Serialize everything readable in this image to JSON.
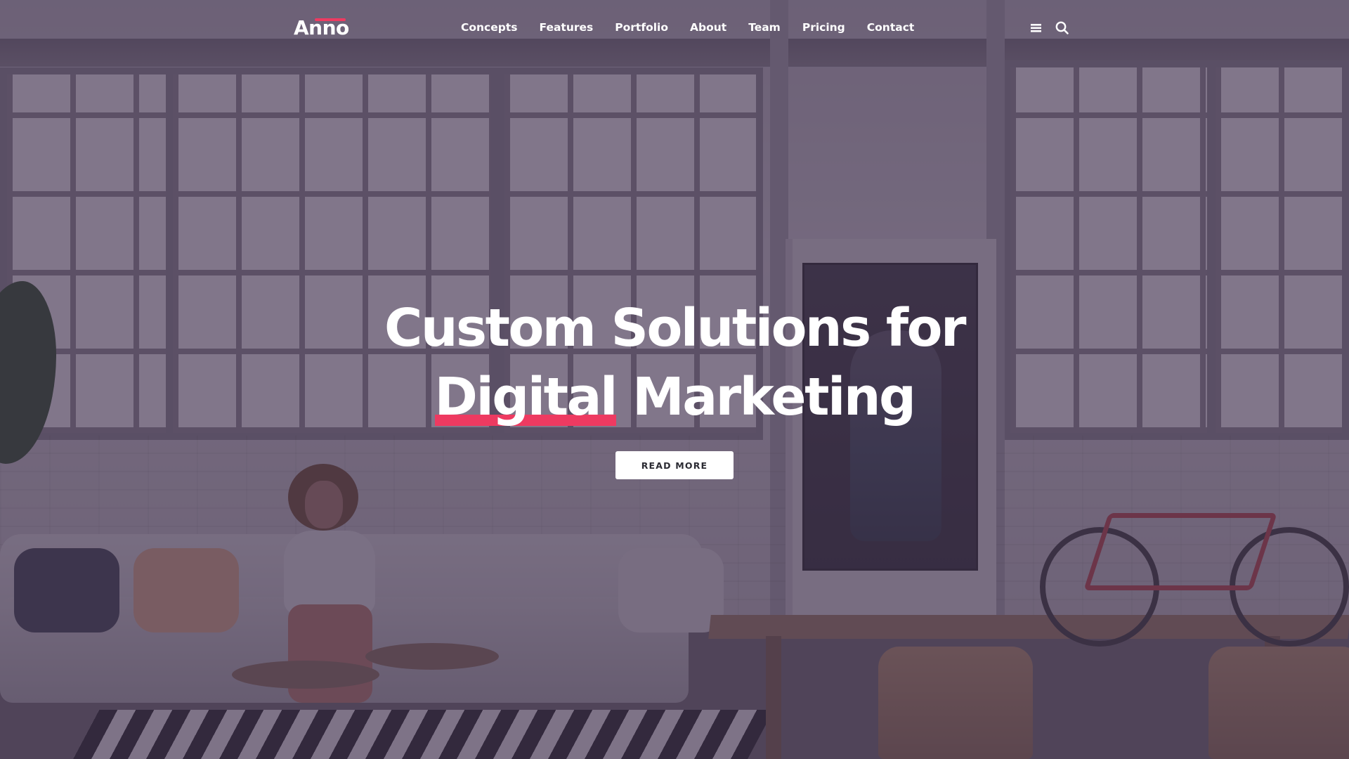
{
  "header": {
    "logo": "Anno",
    "nav": [
      {
        "label": "Concepts"
      },
      {
        "label": "Features"
      },
      {
        "label": "Portfolio"
      },
      {
        "label": "About"
      },
      {
        "label": "Team"
      },
      {
        "label": "Pricing"
      },
      {
        "label": "Contact"
      }
    ],
    "icons": [
      "menu-icon",
      "search-icon"
    ]
  },
  "hero": {
    "headline_line1": "Custom Solutions for",
    "headline_highlight": "Digital",
    "headline_rest": " Marketing",
    "cta_label": "READ MORE"
  },
  "colors": {
    "accent": "#ee3a61",
    "overlay": "#3e2e4a",
    "text": "#ffffff",
    "button_bg": "#ffffff",
    "button_text": "#2b2b33"
  }
}
